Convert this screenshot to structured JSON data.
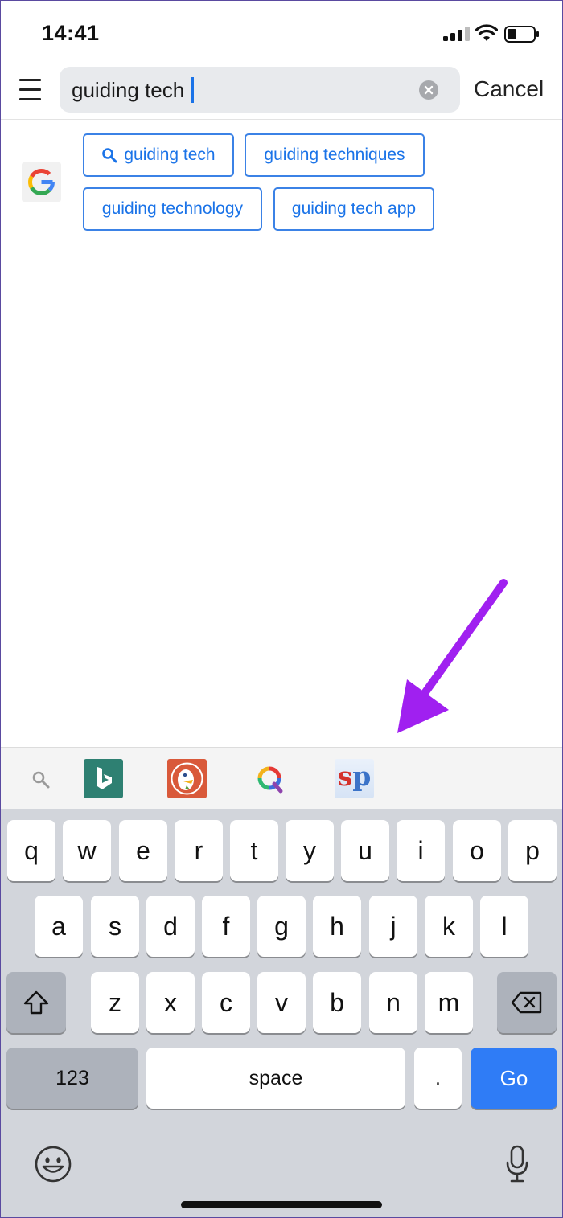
{
  "status_bar": {
    "time": "14:41",
    "icons": [
      "cellular-signal-icon",
      "wifi-icon",
      "battery-icon"
    ]
  },
  "search": {
    "menu_icon": "hamburger-menu-icon",
    "query": "guiding tech",
    "clear_icon": "clear-circle-icon",
    "cancel_label": "Cancel"
  },
  "suggestions": {
    "provider_icon": "google-logo-icon",
    "chips": [
      {
        "label": "guiding tech",
        "icon": "search-icon"
      },
      {
        "label": "guiding techniques"
      },
      {
        "label": "guiding technology"
      },
      {
        "label": "guiding tech app"
      }
    ]
  },
  "engine_bar": {
    "engines": [
      "search-icon",
      "bing-icon",
      "duckduckgo-icon",
      "qwant-icon",
      "startpage-icon"
    ],
    "startpage_label": "sp"
  },
  "annotation": {
    "color": "#a020f0"
  },
  "keyboard": {
    "row1": [
      "q",
      "w",
      "e",
      "r",
      "t",
      "y",
      "u",
      "i",
      "o",
      "p"
    ],
    "row2": [
      "a",
      "s",
      "d",
      "f",
      "g",
      "h",
      "j",
      "k",
      "l"
    ],
    "row3": [
      "z",
      "x",
      "c",
      "v",
      "b",
      "n",
      "m"
    ],
    "numbers_label": "123",
    "space_label": "space",
    "period_label": ".",
    "go_label": "Go",
    "go_color": "#2f7cf6"
  }
}
